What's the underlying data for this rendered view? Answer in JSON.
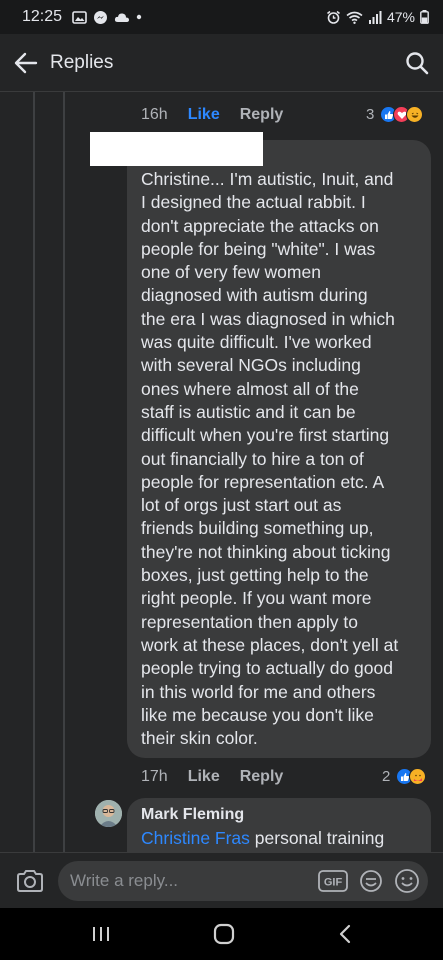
{
  "status_bar": {
    "time": "12:25",
    "battery": "47%"
  },
  "header": {
    "title": "Replies"
  },
  "previous_comment": {
    "time": "16h",
    "like_label": "Like",
    "reply_label": "Reply",
    "reaction_count": "3"
  },
  "comment": {
    "text": "Christine... I'm autistic, Inuit, and\nI designed the actual rabbit. I\ndon't appreciate the attacks on\npeople for being \"white\". I was\none of very few women\ndiagnosed with autism during\nthe era I was diagnosed in which\nwas quite difficult. I've worked\nwith several NGOs including\nones where almost all of the\nstaff is autistic and it can be\ndifficult when you're first starting\nout financially to hire a ton of\npeople for representation etc. A\nlot of orgs just start out as\nfriends building something up,\nthey're not thinking about ticking\nboxes, just getting help to the\nright people. If you want more\nrepresentation then apply to\nwork at these places, don't yell at\npeople trying to actually do good\nin this world for me and others\nlike me because you don't like\ntheir skin color.",
    "time": "17h",
    "like_label": "Like",
    "reply_label": "Reply",
    "reaction_count": "2"
  },
  "reply": {
    "author": "Mark Fleming",
    "mention": "Christine Fras",
    "text": " personal training"
  },
  "composer": {
    "placeholder": "Write a reply...",
    "gif_label": "GIF"
  },
  "colors": {
    "accent": "#2d88ff",
    "like_reaction": "#1877f2",
    "love_reaction": "#f33e58",
    "haha_reaction": "#f7b125"
  }
}
